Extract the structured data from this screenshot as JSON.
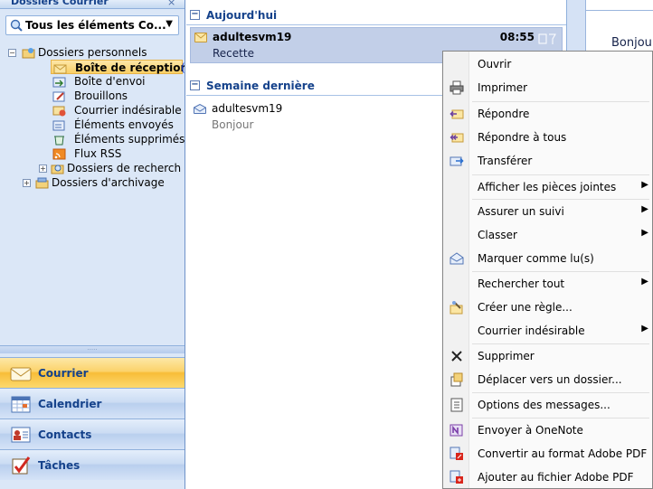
{
  "nav": {
    "header_title": "Dossiers Courrier",
    "close": "×",
    "all_items": "Tous les éléments Co...",
    "all_items_arrow": "▼",
    "tree": [
      {
        "label": "Dossiers personnels",
        "exp": "−"
      },
      {
        "label": "Boîte de réception",
        "count": "("
      },
      {
        "label": "Boîte d'envoi"
      },
      {
        "label": "Brouillons"
      },
      {
        "label": "Courrier indésirable"
      },
      {
        "label": "Éléments envoyés"
      },
      {
        "label": "Éléments supprimés"
      },
      {
        "label": "Flux RSS"
      },
      {
        "label": "Dossiers de recherch",
        "exp": "+"
      },
      {
        "label": "Dossiers d'archivage",
        "exp": "+"
      }
    ],
    "splitter": "·····",
    "buttons": [
      {
        "label": "Courrier"
      },
      {
        "label": "Calendrier"
      },
      {
        "label": "Contacts"
      },
      {
        "label": "Tâches"
      }
    ]
  },
  "list": {
    "groups": [
      {
        "label": "Aujourd'hui",
        "exp": "−"
      },
      {
        "label": "Semaine dernière",
        "exp": "−"
      }
    ],
    "mails": [
      {
        "from": "adultesvm19",
        "subject": "Recette",
        "time": "08:55"
      },
      {
        "from": "adultesvm19",
        "subject": "Bonjour"
      }
    ]
  },
  "reading": {
    "text": "Bonjour"
  },
  "context_menu": {
    "items": [
      {
        "label": "Ouvrir",
        "icon": "none"
      },
      {
        "label": "Imprimer",
        "icon": "printer-icon"
      },
      {
        "label": "Répondre",
        "icon": "reply-icon"
      },
      {
        "label": "Répondre à tous",
        "icon": "reply-all-icon"
      },
      {
        "label": "Transférer",
        "icon": "forward-icon"
      },
      {
        "label": "Afficher les pièces jointes",
        "submenu": "▶"
      },
      {
        "label": "Assurer un suivi",
        "submenu": "▶"
      },
      {
        "label": "Classer",
        "submenu": "▶"
      },
      {
        "label": "Marquer comme lu(s)",
        "icon": "mark-read-icon"
      },
      {
        "label": "Rechercher tout",
        "submenu": "▶"
      },
      {
        "label": "Créer une règle...",
        "icon": "rule-icon"
      },
      {
        "label": "Courrier indésirable",
        "submenu": "▶"
      },
      {
        "label": "Supprimer",
        "icon": "delete-icon"
      },
      {
        "label": "Déplacer vers un dossier...",
        "icon": "move-folder-icon"
      },
      {
        "label": "Options des messages...",
        "icon": "options-icon"
      },
      {
        "label": "Envoyer à OneNote",
        "icon": "onenote-icon"
      },
      {
        "label": "Convertir au format Adobe PDF",
        "icon": "pdf-convert-icon"
      },
      {
        "label": "Ajouter au fichier Adobe PDF",
        "icon": "pdf-append-icon"
      }
    ]
  },
  "colors": {
    "accent_blue": "#15428b",
    "selected_orange": "#f8bd38",
    "selected_mail": "#c2cfe8",
    "menu_bg": "#fafafa"
  }
}
